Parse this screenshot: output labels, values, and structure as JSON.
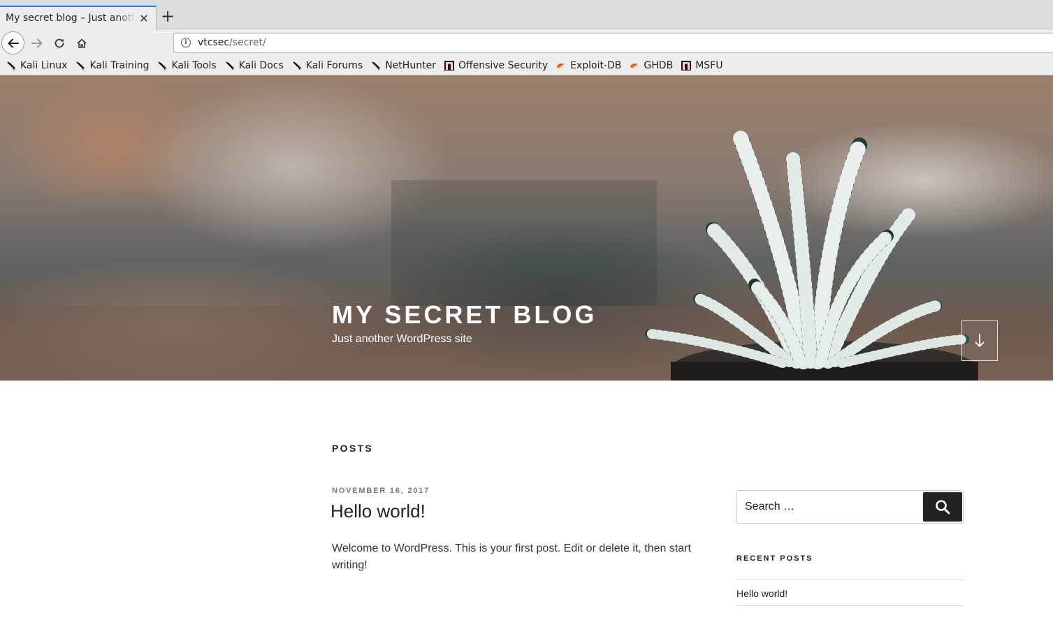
{
  "browser": {
    "tab_title": "My secret blog – Just another WordPress site",
    "window_title_fragment": "y   ",
    "url_host": "vtcsec",
    "url_path": "/secret/",
    "bookmarks": [
      {
        "label": "Kali Linux",
        "icon": "kali-dragon-icon"
      },
      {
        "label": "Kali Training",
        "icon": "kali-dragon-icon"
      },
      {
        "label": "Kali Tools",
        "icon": "kali-dragon-icon"
      },
      {
        "label": "Kali Docs",
        "icon": "kali-dragon-icon"
      },
      {
        "label": "Kali Forums",
        "icon": "kali-dragon-icon"
      },
      {
        "label": "NetHunter",
        "icon": "kali-dragon-icon"
      },
      {
        "label": "Offensive Security",
        "icon": "offsec-icon"
      },
      {
        "label": "Exploit-DB",
        "icon": "exploitdb-icon"
      },
      {
        "label": "GHDB",
        "icon": "exploitdb-icon"
      },
      {
        "label": "MSFU",
        "icon": "offsec-icon"
      }
    ]
  },
  "site": {
    "title": "MY SECRET BLOG",
    "tagline": "Just another WordPress site"
  },
  "main": {
    "posts_heading": "POSTS",
    "post": {
      "date": "NOVEMBER 16, 2017",
      "title": "Hello world!",
      "excerpt": "Welcome to WordPress. This is your first post. Edit or delete it, then start writing!"
    }
  },
  "sidebar": {
    "search_placeholder": "Search …",
    "recent_posts_heading": "RECENT POSTS",
    "recent_posts": [
      "Hello world!"
    ]
  },
  "colors": {
    "tab_accent": "#0a84ff",
    "text_dark": "#222222",
    "search_button_bg": "#222222"
  }
}
